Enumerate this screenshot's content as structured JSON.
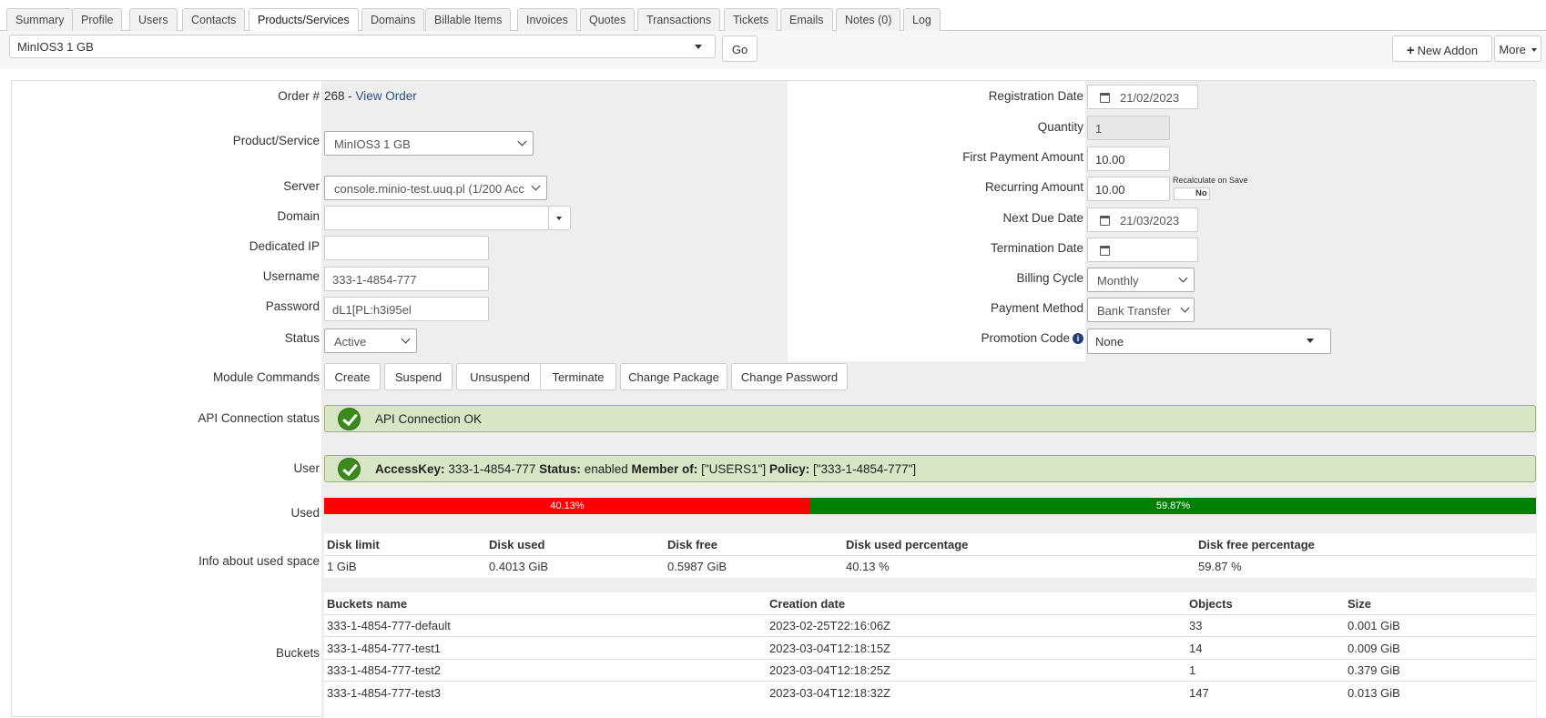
{
  "tabs": [
    "Summary",
    "Profile",
    "Users",
    "Contacts",
    "Products/Services",
    "Domains",
    "Billable Items",
    "Invoices",
    "Quotes",
    "Transactions",
    "Tickets",
    "Emails",
    "Notes (0)",
    "Log"
  ],
  "active_tab": "Products/Services",
  "service_selector": {
    "value": "MinIOS3 1 GB",
    "go_label": "Go"
  },
  "actions": {
    "new_addon": "New Addon",
    "more": "More"
  },
  "form": {
    "order_label": "Order #",
    "order_number": "268",
    "order_separator": " - ",
    "view_order_link": "View Order",
    "product_label": "Product/Service",
    "product_value": "MinIOS3 1 GB",
    "server_label": "Server",
    "server_value": "console.minio-test.uuq.pl (1/200 Acc",
    "domain_label": "Domain",
    "domain_value": "",
    "dedicated_ip_label": "Dedicated IP",
    "dedicated_ip_value": "",
    "username_label": "Username",
    "username_value": "333-1-4854-777",
    "password_label": "Password",
    "password_value": "dL1[PL:h3i95el",
    "status_label": "Status",
    "status_value": "Active",
    "registration_date_label": "Registration Date",
    "registration_date_value": "21/02/2023",
    "quantity_label": "Quantity",
    "quantity_value": "1",
    "first_payment_label": "First Payment Amount",
    "first_payment_value": "10.00",
    "recurring_label": "Recurring Amount",
    "recurring_value": "10.00",
    "recalculate_label": "Recalculate on Save",
    "recalculate_value": "No",
    "next_due_label": "Next Due Date",
    "next_due_value": "21/03/2023",
    "termination_label": "Termination Date",
    "termination_value": "",
    "billing_cycle_label": "Billing Cycle",
    "billing_cycle_value": "Monthly",
    "payment_method_label": "Payment Method",
    "payment_method_value": "Bank Transfer",
    "promotion_label": "Promotion Code",
    "promotion_value": "None"
  },
  "module_commands": {
    "label": "Module Commands",
    "buttons": [
      "Create",
      "Suspend",
      "Unsuspend",
      "Terminate",
      "Change Package",
      "Change Password"
    ]
  },
  "api_status": {
    "label": "API Connection status",
    "text": "API Connection OK"
  },
  "user_info": {
    "label": "User",
    "access_key_label": "AccessKey:",
    "access_key": "333-1-4854-777",
    "status_label": "Status:",
    "status": "enabled",
    "member_label": "Member of:",
    "member": "[\"USERS1\"]",
    "policy_label": "Policy:",
    "policy": "[\"333-1-4854-777\"]"
  },
  "usage": {
    "label": "Used",
    "used_fraction": 0.4013,
    "used_text": "40.13%",
    "free_text": "59.87%",
    "used_color": "#ff0000",
    "free_color": "#008000"
  },
  "space_info": {
    "label": "Info about used space",
    "headers": [
      "Disk limit",
      "Disk used",
      "Disk free",
      "Disk used percentage",
      "Disk free percentage"
    ],
    "row": [
      "1 GiB",
      "0.4013 GiB",
      "0.5987 GiB",
      "40.13 %",
      "59.87 %"
    ]
  },
  "buckets": {
    "label": "Buckets",
    "headers": [
      "Buckets name",
      "Creation date",
      "Objects",
      "Size"
    ],
    "rows": [
      [
        "333-1-4854-777-default",
        "2023-02-25T22:16:06Z",
        "33",
        "0.001 GiB"
      ],
      [
        "333-1-4854-777-test1",
        "2023-03-04T12:18:15Z",
        "14",
        "0.009 GiB"
      ],
      [
        "333-1-4854-777-test2",
        "2023-03-04T12:18:25Z",
        "1",
        "0.379 GiB"
      ],
      [
        "333-1-4854-777-test3",
        "2023-03-04T12:18:32Z",
        "147",
        "0.013 GiB"
      ]
    ]
  }
}
